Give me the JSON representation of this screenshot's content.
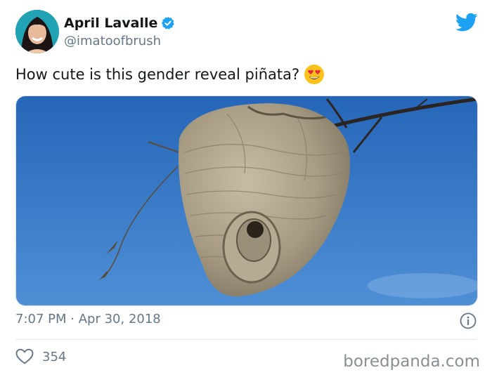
{
  "user": {
    "name": "April Lavalle",
    "handle": "@imatoofbrush"
  },
  "tweet": {
    "text": "How cute is this gender reveal piñata?",
    "emoji": "heart-eyes-emoji",
    "time": "7:07 PM",
    "date": "Apr 30, 2018",
    "meta_separator": "·",
    "likes": "354"
  },
  "icons": {
    "verified": "verified-badge-icon",
    "brand": "twitter-bird-icon",
    "info": "info-icon",
    "like": "heart-outline-icon"
  },
  "colors": {
    "twitter_blue": "#1da1f2",
    "sky": "#2f6fc0",
    "nest": "#a59a84"
  },
  "watermark": "boredpanda.com"
}
